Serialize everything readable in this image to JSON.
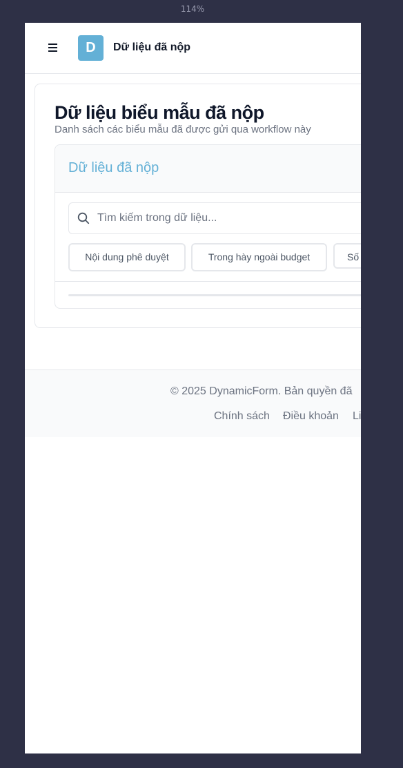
{
  "browser": {
    "zoom": "114%"
  },
  "topbar": {
    "logo_letter": "D",
    "title": "Dữ liệu đã nộp",
    "menu_icon": "hamburger-icon"
  },
  "page": {
    "title": "Dữ liệu biểu mẫu đã nộp",
    "subtitle": "Danh sách các biểu mẫu đã được gửi qua workflow này"
  },
  "data_panel": {
    "title": "Dữ liệu đã nộp",
    "search": {
      "placeholder": "Tìm kiếm trong dữ liệu...",
      "value": "",
      "icon": "search-icon"
    },
    "filters": [
      {
        "label": "Nội dung phê duyệt"
      },
      {
        "label": "Trong hày ngoài budget"
      },
      {
        "label": "Số"
      }
    ]
  },
  "footer": {
    "copyright": "© 2025 DynamicForm. Bản quyền đã",
    "links": [
      {
        "label": "Chính sách"
      },
      {
        "label": "Điều khoản"
      },
      {
        "label": "Li"
      }
    ]
  },
  "colors": {
    "brand": "#63b0d6",
    "background": "#2e3046",
    "text": "#111827",
    "muted": "#6b7280"
  }
}
